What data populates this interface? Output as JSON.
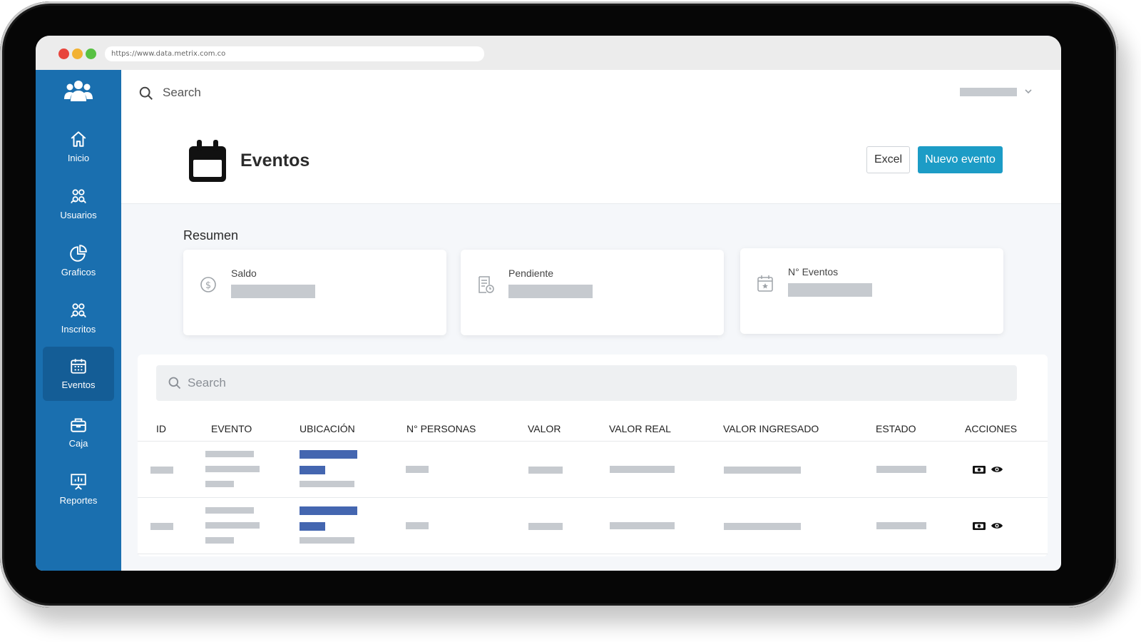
{
  "browser": {
    "url": "https://www.data.metrix.com.co",
    "dot_colors": [
      "#e8453c",
      "#f2b233",
      "#58c142"
    ]
  },
  "sidebar": {
    "background": "#1a6faf",
    "items": [
      {
        "label": "Inicio",
        "icon": "home-icon"
      },
      {
        "label": "Usuarios",
        "icon": "users-icon"
      },
      {
        "label": "Graficos",
        "icon": "pie-chart-icon"
      },
      {
        "label": "Inscritos",
        "icon": "users-icon"
      },
      {
        "label": "Eventos",
        "icon": "calendar-icon",
        "active": true
      },
      {
        "label": "Caja",
        "icon": "cash-box-icon"
      },
      {
        "label": "Reportes",
        "icon": "presentation-icon"
      }
    ]
  },
  "topbar": {
    "search_label": "Search"
  },
  "header": {
    "title": "Eventos",
    "excel_label": "Excel",
    "new_label": "Nuevo evento",
    "accent": "#1c9cc6"
  },
  "resumen": {
    "title": "Resumen",
    "cards": [
      {
        "label": "Saldo",
        "icon": "dollar-icon"
      },
      {
        "label": "Pendiente",
        "icon": "document-clock-icon"
      },
      {
        "label": "N° Eventos",
        "icon": "calendar-star-icon"
      }
    ]
  },
  "table": {
    "search_placeholder": "Search",
    "columns": [
      "ID",
      "EVENTO",
      "UBICACIÓN",
      "N° PERSONAS",
      "VALOR",
      "VALOR REAL",
      "VALOR INGRESADO",
      "ESTADO",
      "ACCIONES"
    ],
    "row_actions": [
      "cash-icon",
      "eye-icon"
    ]
  }
}
